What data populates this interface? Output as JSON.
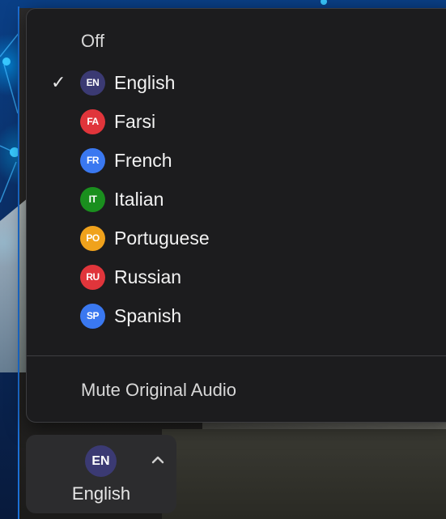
{
  "menu": {
    "off_label": "Off",
    "mute_label": "Mute Original Audio",
    "items": [
      {
        "code": "EN",
        "label": "English",
        "color": "#3b3a73",
        "selected": true
      },
      {
        "code": "FA",
        "label": "Farsi",
        "color": "#e0353b",
        "selected": false
      },
      {
        "code": "FR",
        "label": "French",
        "color": "#3a78f0",
        "selected": false
      },
      {
        "code": "IT",
        "label": "Italian",
        "color": "#1a8f1e",
        "selected": false
      },
      {
        "code": "PO",
        "label": "Portuguese",
        "color": "#f0a21c",
        "selected": false
      },
      {
        "code": "RU",
        "label": "Russian",
        "color": "#e0353b",
        "selected": false
      },
      {
        "code": "SP",
        "label": "Spanish",
        "color": "#3a78f0",
        "selected": false
      }
    ],
    "check_glyph": "✓"
  },
  "toolbar": {
    "language_code": "EN",
    "language_label": "English",
    "chevron_icon": "chevron-up-icon"
  }
}
